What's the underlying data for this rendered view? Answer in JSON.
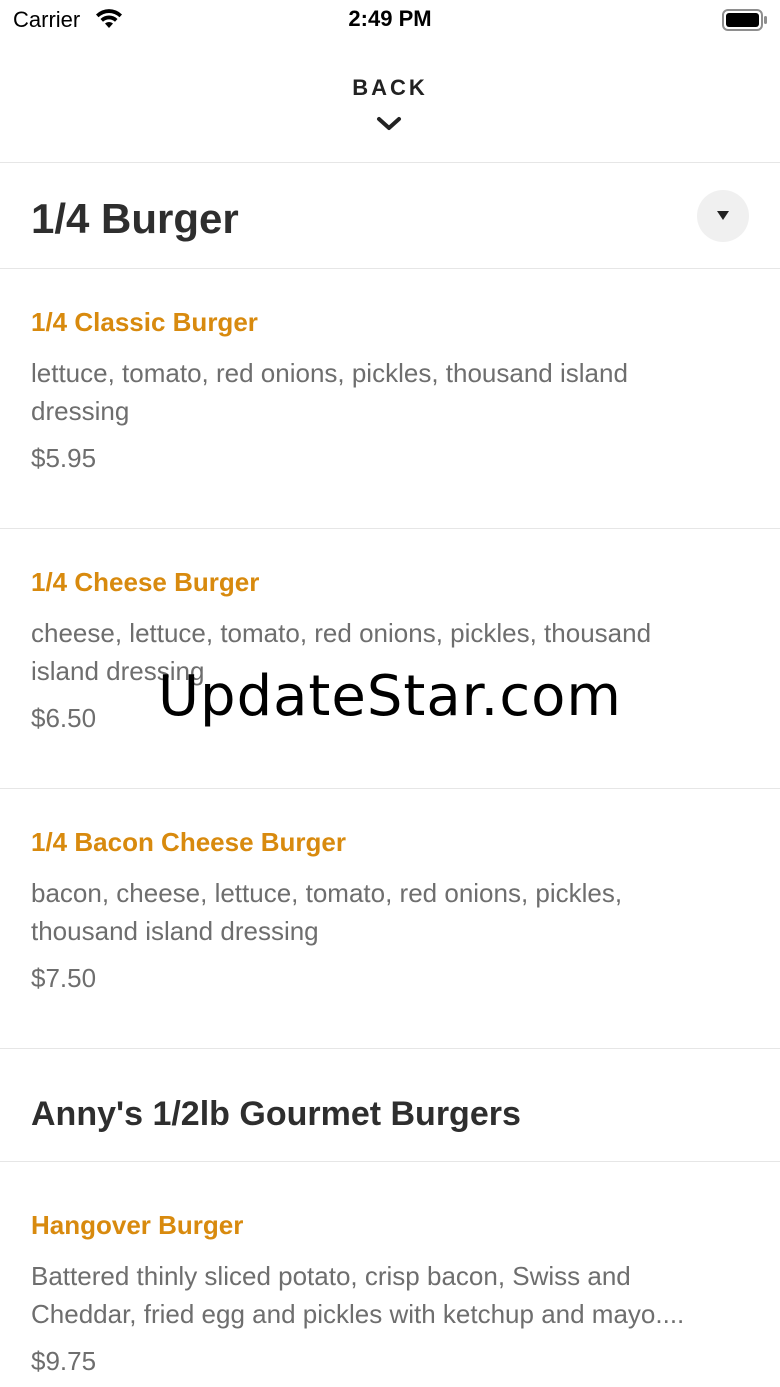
{
  "status_bar": {
    "carrier": "Carrier",
    "time": "2:49 PM",
    "icons": [
      "wifi-icon",
      "battery-icon"
    ]
  },
  "header": {
    "back_label": "BACK",
    "back_icon": "chevron-down-icon"
  },
  "sections": [
    {
      "title": "1/4 Burger",
      "toggle_icon": "caret-down-icon",
      "items": [
        {
          "name": "1/4 Classic Burger",
          "description": "lettuce, tomato, red onions, pickles, thousand island\ndressing",
          "price": "$5.95"
        },
        {
          "name": "1/4 Cheese Burger",
          "description": "cheese, lettuce, tomato, red onions, pickles, thousand\nisland dressing",
          "price": "$6.50"
        },
        {
          "name": "1/4 Bacon Cheese Burger",
          "description": "bacon, cheese, lettuce, tomato, red onions, pickles,\nthousand island dressing",
          "price": "$7.50"
        }
      ]
    },
    {
      "title": "Anny's 1/2lb Gourmet Burgers",
      "items": [
        {
          "name": "Hangover Burger",
          "description": "Battered thinly sliced potato, crisp bacon, Swiss and\nCheddar, fried egg and pickles with ketchup and mayo....",
          "price": "$9.75"
        }
      ]
    }
  ],
  "watermark": "UpdateStar.com",
  "colors": {
    "item_name": "#d88a0e",
    "description": "#6e6e6e",
    "title": "#2e2e2e",
    "divider": "#e6e6e6"
  }
}
